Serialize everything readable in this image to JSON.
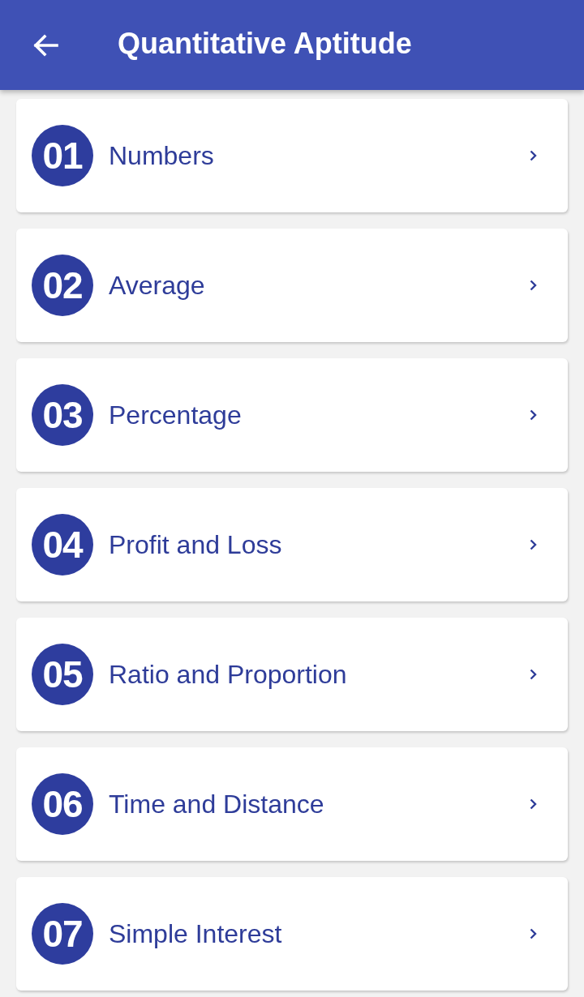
{
  "app_bar": {
    "title": "Quantitative Aptitude"
  },
  "topics": [
    {
      "number": "01",
      "title": "Numbers"
    },
    {
      "number": "02",
      "title": "Average"
    },
    {
      "number": "03",
      "title": "Percentage"
    },
    {
      "number": "04",
      "title": "Profit and Loss"
    },
    {
      "number": "05",
      "title": "Ratio and Proportion"
    },
    {
      "number": "06",
      "title": "Time and Distance"
    },
    {
      "number": "07",
      "title": "Simple Interest"
    }
  ]
}
